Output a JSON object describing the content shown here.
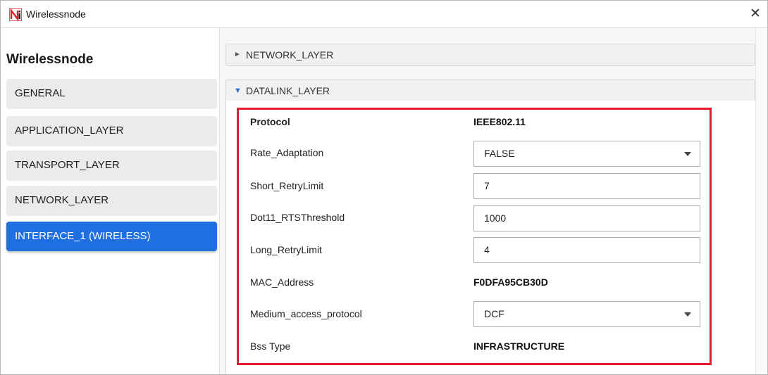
{
  "window": {
    "title": "Wirelessnode",
    "close_glyph": "✕"
  },
  "sidebar": {
    "title": "Wirelessnode",
    "items": [
      {
        "label": "GENERAL"
      },
      {
        "label": "APPLICATION_LAYER"
      },
      {
        "label": "TRANSPORT_LAYER"
      },
      {
        "label": "NETWORK_LAYER"
      },
      {
        "label": "INTERFACE_1 (WIRELESS)"
      }
    ],
    "active_item": "INTERFACE_1 (WIRELESS)"
  },
  "sections": {
    "network": {
      "label": "NETWORK_LAYER",
      "expanded": false,
      "arrow": "►"
    },
    "datalink": {
      "label": "DATALINK_LAYER",
      "expanded": true,
      "arrow": "▼"
    }
  },
  "datalink_props": {
    "protocol": {
      "label": "Protocol",
      "value": "IEEE802.11"
    },
    "rate_adaptation": {
      "label": "Rate_Adaptation",
      "value": "FALSE"
    },
    "short_retry_limit": {
      "label": "Short_RetryLimit",
      "value": "7"
    },
    "rts_threshold": {
      "label": "Dot11_RTSThreshold",
      "value": "1000"
    },
    "long_retry_limit": {
      "label": "Long_RetryLimit",
      "value": "4"
    },
    "mac_address": {
      "label": "MAC_Address",
      "value": "F0DFA95CB30D"
    },
    "medium_access": {
      "label": "Medium_access_protocol",
      "value": "DCF"
    },
    "bss_type": {
      "label": "Bss Type",
      "value": "INFRASTRUCTURE"
    }
  },
  "colors": {
    "accent": "#1f6fe0",
    "highlight_border": "#e21c2b",
    "logo_red": "#d8202a"
  },
  "icons": {
    "app": "netsim-logo-icon",
    "close": "close-icon",
    "collapsed": "triangle-right-icon",
    "expanded": "triangle-down-icon",
    "dropdown": "chevron-down-icon"
  }
}
